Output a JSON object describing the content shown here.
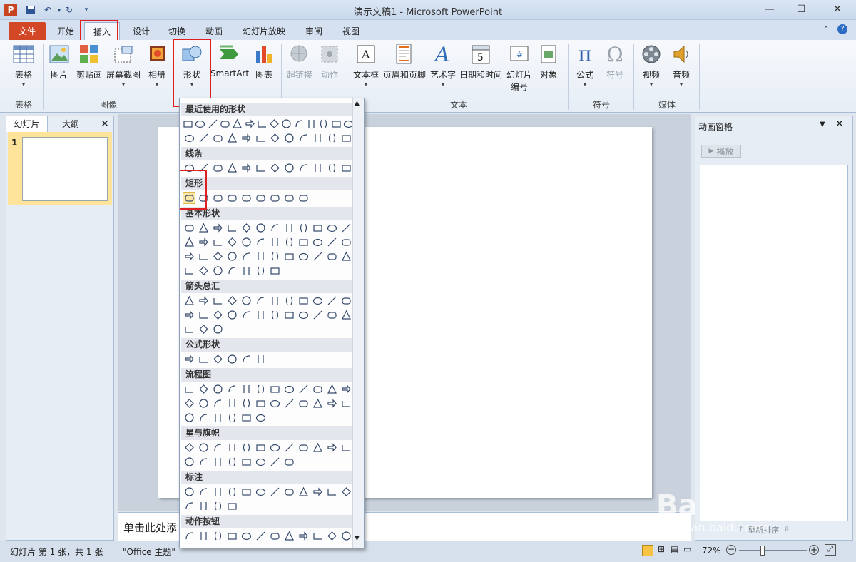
{
  "window": {
    "title": "演示文稿1 - Microsoft PowerPoint"
  },
  "quick_access": {
    "app_icon": "P",
    "save_icon": "save-icon",
    "undo_icon": "undo-icon",
    "redo_icon": "redo-icon"
  },
  "window_controls": {
    "minimize": "—",
    "maximize": "☐",
    "close": "✕"
  },
  "tabs": [
    "文件",
    "开始",
    "插入",
    "设计",
    "切换",
    "动画",
    "幻灯片放映",
    "审阅",
    "视图"
  ],
  "ribbon": {
    "groups": [
      {
        "label": "表格"
      },
      {
        "label": "图像"
      },
      {
        "label": "文本"
      },
      {
        "label": "符号"
      },
      {
        "label": "媒体"
      }
    ],
    "buttons": {
      "table": "表格",
      "picture": "图片",
      "clipart": "剪贴画",
      "screenshot": "屏幕截图",
      "album": "相册",
      "shapes": "形状",
      "smartart": "SmartArt",
      "chart": "图表",
      "hyperlink": "超链接",
      "action": "动作",
      "textbox": "文本框",
      "header_footer": "页眉和页脚",
      "wordart": "艺术字",
      "datetime": "日期和时间",
      "slide_number_1": "幻灯片",
      "slide_number_2": "编号",
      "object": "对象",
      "equation": "公式",
      "symbol": "符号",
      "video": "视频",
      "audio": "音频"
    }
  },
  "left_pane": {
    "tab_slides": "幻灯片",
    "tab_outline": "大纲",
    "close": "✕",
    "slide_index": "1"
  },
  "notes": {
    "placeholder": "单击此处添"
  },
  "right_pane": {
    "title": "动画窗格",
    "play": "播放",
    "reorder": "重新排序"
  },
  "status": {
    "slide_info": "幻灯片 第 1 张，共 1 张",
    "theme": "\"Office 主题\"",
    "zoom": "72%"
  },
  "dropdown": {
    "sections": [
      "最近使用的形状",
      "线条",
      "矩形",
      "基本形状",
      "箭头总汇",
      "公式形状",
      "流程图",
      "星与旗帜",
      "标注",
      "动作按钮"
    ]
  },
  "watermark": {
    "text": "Baidu经验",
    "url": "jingyan.baidu.com"
  }
}
